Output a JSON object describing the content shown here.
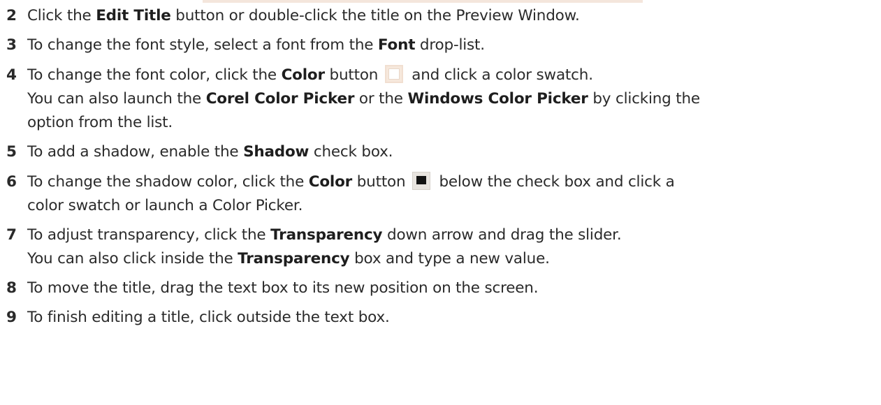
{
  "steps": [
    {
      "num": "2",
      "lines": [
        {
          "t1": "Click the ",
          "b1": "Edit Title",
          "t2": " button or double-click the title on the Preview Window."
        }
      ]
    },
    {
      "num": "3",
      "lines": [
        {
          "t1": "To change the font style, select a font from the ",
          "b1": "Font",
          "t2": " drop-list."
        }
      ]
    },
    {
      "num": "4",
      "lines": [
        {
          "t1": "To change the font color, click the ",
          "b1": "Color",
          "t2": " button",
          "t3": "and click a color swatch."
        },
        {
          "t1": "You can also launch the ",
          "b1": "Corel Color Picker",
          "t2": " or the ",
          "b2": "Windows Color Picker",
          "t3": " by clicking the"
        },
        {
          "t1": "option from the list."
        }
      ]
    },
    {
      "num": "5",
      "lines": [
        {
          "t1": "To add a shadow, enable the ",
          "b1": "Shadow",
          "t2": " check box."
        }
      ]
    },
    {
      "num": "6",
      "lines": [
        {
          "t1": "To change the shadow color, click the ",
          "b1": "Color",
          "t2": " button",
          "t3": "below the check box and click a"
        },
        {
          "t1": "color swatch or launch a Color Picker."
        }
      ]
    },
    {
      "num": "7",
      "lines": [
        {
          "t1": "To adjust transparency, click the ",
          "b1": "Transparency",
          "t2": " down arrow and drag the slider."
        },
        {
          "t1": "You can also click inside the ",
          "b1": "Transparency",
          "t2": " box and type a new value."
        }
      ]
    },
    {
      "num": "8",
      "lines": [
        {
          "t1": "To move the title, drag the text box to its new position on the screen."
        }
      ]
    },
    {
      "num": "9",
      "lines": [
        {
          "t1": "To finish editing a title, click outside the text box."
        }
      ]
    }
  ],
  "icons": {
    "font_color_swatch": "color-swatch-white-icon",
    "shadow_color_swatch": "color-swatch-black-icon"
  }
}
